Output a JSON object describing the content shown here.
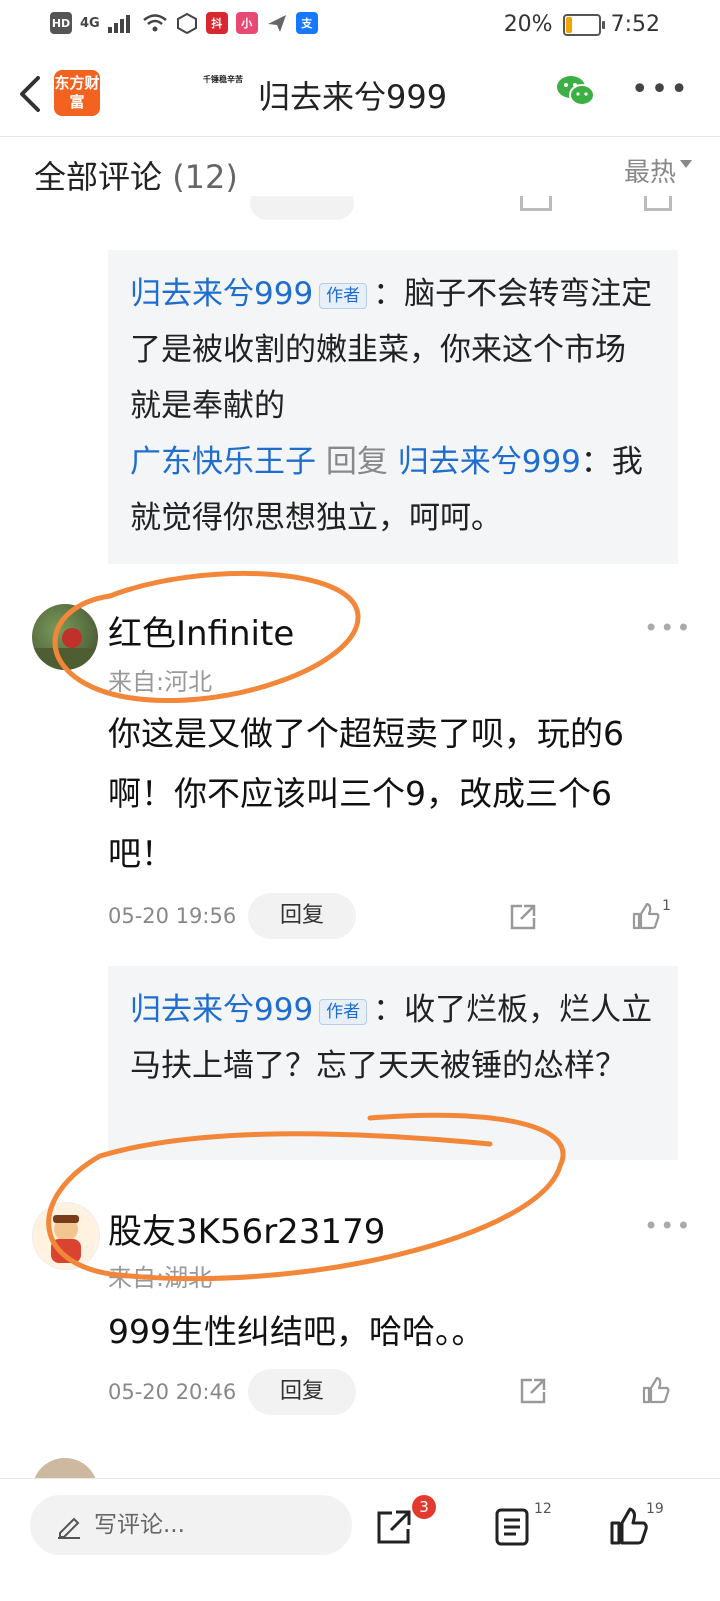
{
  "status_bar": {
    "network": "4G",
    "hd": "HD",
    "battery_percent": "20%",
    "battery_level": 0.2,
    "time": "7:52"
  },
  "header": {
    "logo_text": "东方财富",
    "mini_logo_text": "千锤稳辛苦",
    "title": "归去来兮999"
  },
  "comments_header": {
    "title": "全部评论",
    "count": "(12)",
    "sort": "最热"
  },
  "quote1": {
    "author": "归去来兮999",
    "author_tag": "作者",
    "text": "：脑子不会转弯注定了是被收割的嫩韭菜，你来这个市场就是奉献的",
    "reply_from": "广东快乐王子",
    "reply_word": "回复",
    "reply_to": "归去来兮999",
    "reply_text": "：我就觉得你思想独立，呵呵。"
  },
  "comment1": {
    "username": "红色Infinite",
    "location": "来自:河北",
    "text": "你这是又做了个超短卖了呗，玩的6啊！你不应该叫三个9，改成三个6吧！",
    "time": "05-20 19:56",
    "reply_label": "回复",
    "likes": "1"
  },
  "quote2": {
    "author": "归去来兮999",
    "author_tag": "作者",
    "text": "：收了烂板，烂人立马扶上墙了？忘了天天被锤的怂样？"
  },
  "comment2": {
    "username": "股友3K56r23179",
    "location": "来自:湖北",
    "text": "999生性纠结吧，哈哈。。",
    "time": "05-20 20:46",
    "reply_label": "回复"
  },
  "bottom_bar": {
    "comment_placeholder": "写评论...",
    "share_badge": "3",
    "comment_count": "12",
    "like_count": "19"
  },
  "colors": {
    "brand_orange": "#f4621f",
    "link_blue": "#1f6ecf",
    "annotation_orange": "#f2873a",
    "badge_red": "#e23a2e"
  }
}
